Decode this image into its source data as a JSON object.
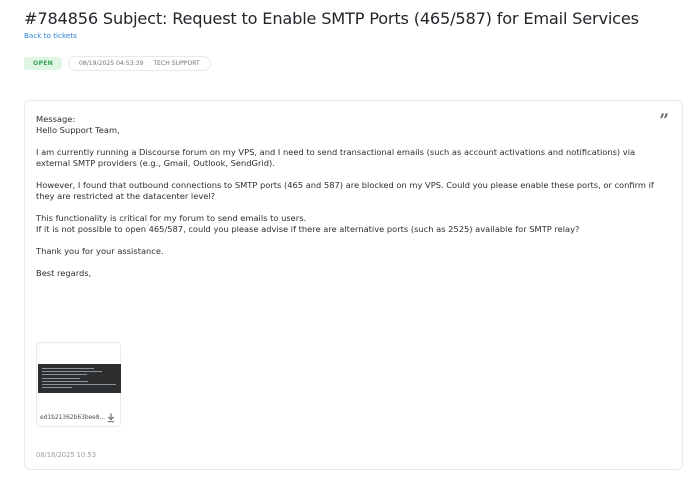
{
  "ticket": {
    "title": "#784856 Subject: Request to Enable SMTP Ports (465/587) for Email Services",
    "back_link": "Back to tickets",
    "status": "OPEN",
    "datetime": "08/19/2025 04:53:39",
    "department": "TECH SUPPORT"
  },
  "message": {
    "label": "Message:",
    "greeting": "Hello Support Team,",
    "p1": "I am currently running a Discourse forum on my VPS, and I need to send transactional emails (such as account activations and notifications) via external SMTP providers (e.g., Gmail, Outlook, SendGrid).",
    "p2": "However, I found that outbound connections to SMTP ports (465 and 587) are blocked on my VPS. Could you please enable these ports, or confirm if they are restricted at the datacenter level?",
    "p3_line1": "This functionality is critical for my forum to send emails to users.",
    "p3_line2": "If it is not possible to open 465/587, could you please advise if there are alternative ports (such as 2525) available for SMTP relay?",
    "thanks": "Thank you for your assistance.",
    "closing": "Best regards,",
    "timestamp": "08/18/2025 10:53"
  },
  "attachment": {
    "filename": "ed1b21362b63bee8...",
    "icon": "download-icon"
  },
  "icons": {
    "quote": "quote-icon"
  },
  "colors": {
    "status_bg": "#dff6e5",
    "status_text": "#3aa35c",
    "link": "#2f80d7"
  }
}
